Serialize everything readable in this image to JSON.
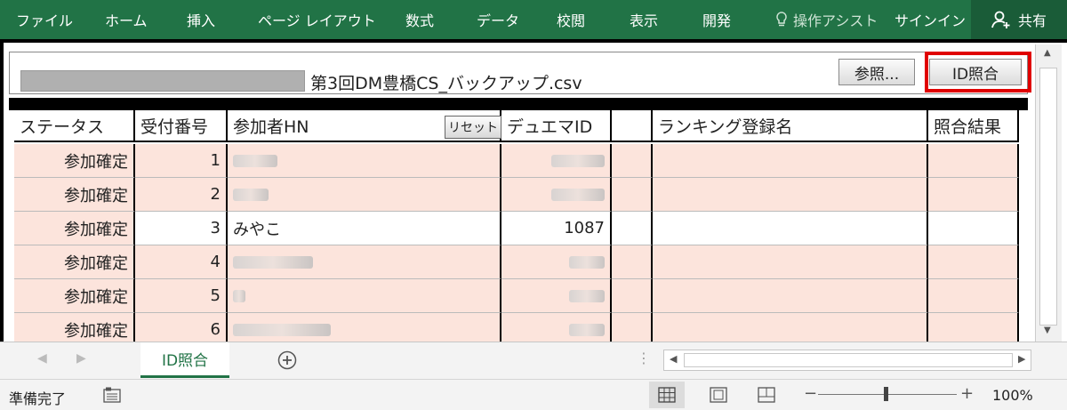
{
  "ribbon": {
    "tabs": [
      "ファイル",
      "ホーム",
      "挿入",
      "ページ レイアウト",
      "数式",
      "データ",
      "校閲",
      "表示",
      "開発"
    ],
    "assist": "操作アシスト",
    "signin": "サインイン",
    "share": "共有"
  },
  "file": {
    "name": "第3回DM豊橋CS_バックアップ.csv",
    "browse_label": "参照...",
    "match_label": "ID照合"
  },
  "table": {
    "headers": [
      "ステータス",
      "受付番号",
      "参加者HN",
      "デュエマID",
      "",
      "ランキング登録名",
      "照合結果"
    ],
    "reset_label": "リセット",
    "rows": [
      {
        "status": "参加確定",
        "num": "1",
        "hn": "",
        "id": ""
      },
      {
        "status": "参加確定",
        "num": "2",
        "hn": "",
        "id": ""
      },
      {
        "status": "参加確定",
        "num": "3",
        "hn": "みやこ",
        "id": "1087"
      },
      {
        "status": "参加確定",
        "num": "4",
        "hn": "",
        "id": ""
      },
      {
        "status": "参加確定",
        "num": "5",
        "hn": "",
        "id": ""
      },
      {
        "status": "参加確定",
        "num": "6",
        "hn": "",
        "id": ""
      }
    ]
  },
  "sheet_tab": "ID照合",
  "status": {
    "ready": "準備完了",
    "zoom": "100%"
  },
  "colors": {
    "ribbon": "#217346",
    "highlight": "#e00000",
    "row_pink": "#fce4dc"
  }
}
